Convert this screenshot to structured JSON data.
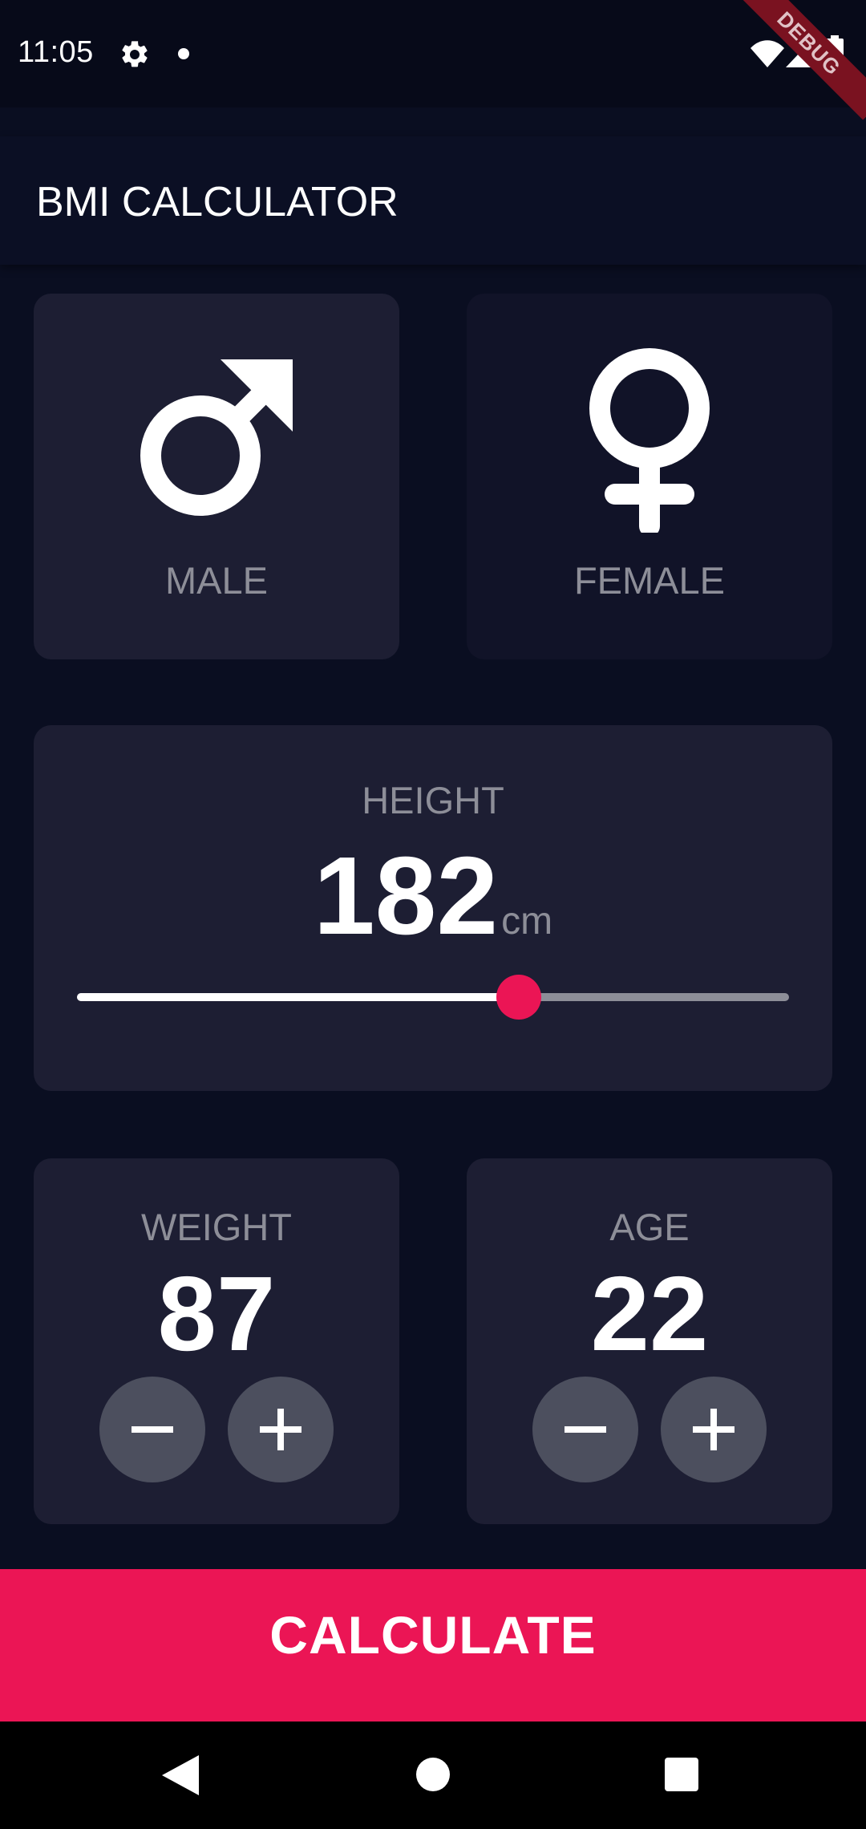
{
  "status_bar": {
    "time": "11:05",
    "icons": [
      "gear-icon",
      "notification-dot-icon",
      "wifi-icon",
      "cell-signal-icon",
      "battery-icon"
    ],
    "debug_banner": "DEBUG"
  },
  "app_bar": {
    "title": "BMI CALCULATOR"
  },
  "gender": {
    "male": {
      "label": "MALE",
      "icon": "male-symbol-icon",
      "selected": true
    },
    "female": {
      "label": "FEMALE",
      "icon": "female-symbol-icon",
      "selected": false
    }
  },
  "height": {
    "label": "HEIGHT",
    "value": "182",
    "unit": "cm",
    "slider_fraction": 0.62
  },
  "weight": {
    "label": "WEIGHT",
    "value": "87",
    "decrement_icon": "minus-icon",
    "increment_icon": "plus-icon"
  },
  "age": {
    "label": "AGE",
    "value": "22",
    "decrement_icon": "minus-icon",
    "increment_icon": "plus-icon"
  },
  "calculate": {
    "label": "CALCULATE"
  },
  "nav_bar": {
    "icons": [
      "back-icon",
      "home-icon",
      "recents-icon"
    ]
  },
  "colors": {
    "background": "#0a0e21",
    "active_card": "#1d1e33",
    "inactive_card": "#111328",
    "accent": "#eb1555",
    "label": "#8d8e98",
    "round_button": "#4c4f5e"
  }
}
